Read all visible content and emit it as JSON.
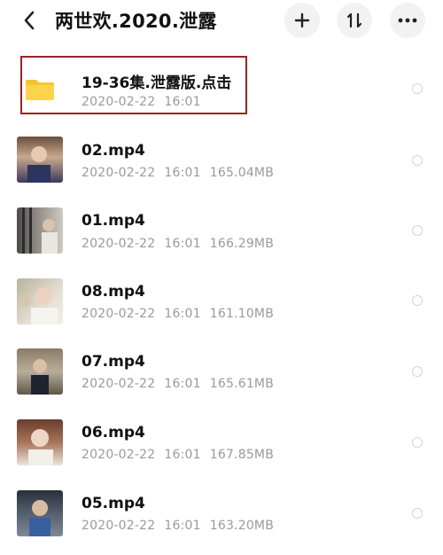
{
  "header": {
    "title": "两世欢.2020.泄露",
    "back_icon": "chevron-left-icon",
    "add_icon": "plus-icon",
    "sort_icon": "sort-icon",
    "more_icon": "more-horizontal-icon"
  },
  "files": [
    {
      "name": "19-36集.泄露版.点击",
      "date": "2020-02-22",
      "time": "16:01",
      "size": "",
      "type": "folder"
    },
    {
      "name": "02.mp4",
      "date": "2020-02-22",
      "time": "16:01",
      "size": "165.04MB",
      "type": "video"
    },
    {
      "name": "01.mp4",
      "date": "2020-02-22",
      "time": "16:01",
      "size": "166.29MB",
      "type": "video"
    },
    {
      "name": "08.mp4",
      "date": "2020-02-22",
      "time": "16:01",
      "size": "161.10MB",
      "type": "video"
    },
    {
      "name": "07.mp4",
      "date": "2020-02-22",
      "time": "16:01",
      "size": "165.61MB",
      "type": "video"
    },
    {
      "name": "06.mp4",
      "date": "2020-02-22",
      "time": "16:01",
      "size": "167.85MB",
      "type": "video"
    },
    {
      "name": "05.mp4",
      "date": "2020-02-22",
      "time": "16:01",
      "size": "163.20MB",
      "type": "video"
    }
  ],
  "colors": {
    "folder": "#f7c52b",
    "highlight_border": "#9b2226"
  }
}
